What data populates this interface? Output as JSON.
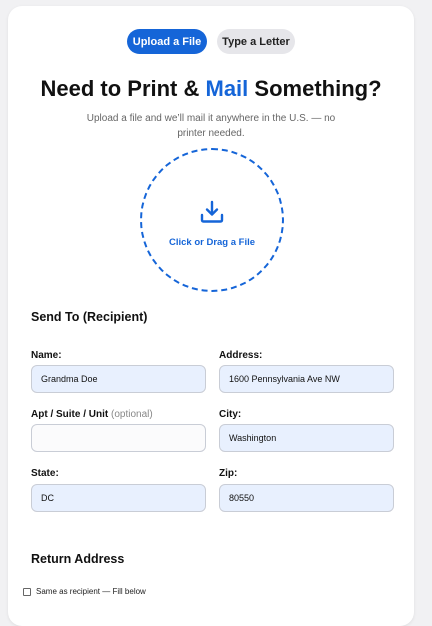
{
  "tabs": {
    "upload_label": "Upload a File",
    "type_label": "Type a Letter"
  },
  "heading": {
    "before": "Need to Print & ",
    "accent": "Mail",
    "after": " Something?"
  },
  "subtitle": "Upload a file and we’ll mail it anywhere in the U.S. — no printer needed.",
  "dropzone": {
    "icon": "download-icon",
    "label": "Click or Drag a File"
  },
  "recipient": {
    "title": "Send To (Recipient)",
    "name_label": "Name:",
    "name_value": "Grandma Doe",
    "address_label": "Address:",
    "address_value": "1600 Pennsylvania Ave NW",
    "apt_label": "Apt / Suite / Unit",
    "apt_optional": "(optional)",
    "apt_value": "",
    "city_label": "City:",
    "city_value": "Washington",
    "state_label": "State:",
    "state_value": "DC",
    "zip_label": "Zip:",
    "zip_value": "80550"
  },
  "return_address": {
    "title": "Return Address",
    "same_as_label": "Same as recipient — Fill below"
  },
  "colors": {
    "accent": "#1565d8",
    "filled_input_bg": "#e8f0fe",
    "inactive_tab_bg": "#e6e6ea"
  }
}
